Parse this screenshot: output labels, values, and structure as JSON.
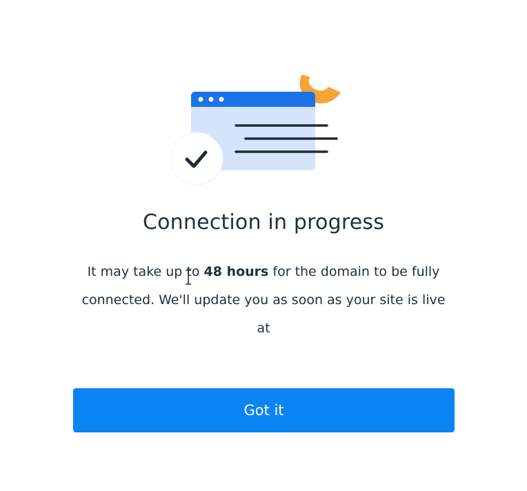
{
  "dialog": {
    "title": "Connection in progress",
    "message_part1": "It may take up to ",
    "message_bold": "48 hours",
    "message_part2": " for the domain to be fully connected. We'll update you as soon as your site is live at",
    "button_label": "Got it"
  },
  "colors": {
    "primary": "#0b84f3",
    "browser_bar": "#1a73e8",
    "browser_body": "#d6e4fb",
    "accent_orange": "#f7a336",
    "text": "#20303c"
  },
  "icons": {
    "illustration": "browser-window-illustration",
    "checkmark": "checkmark-icon",
    "cursor": "text-cursor-icon"
  }
}
